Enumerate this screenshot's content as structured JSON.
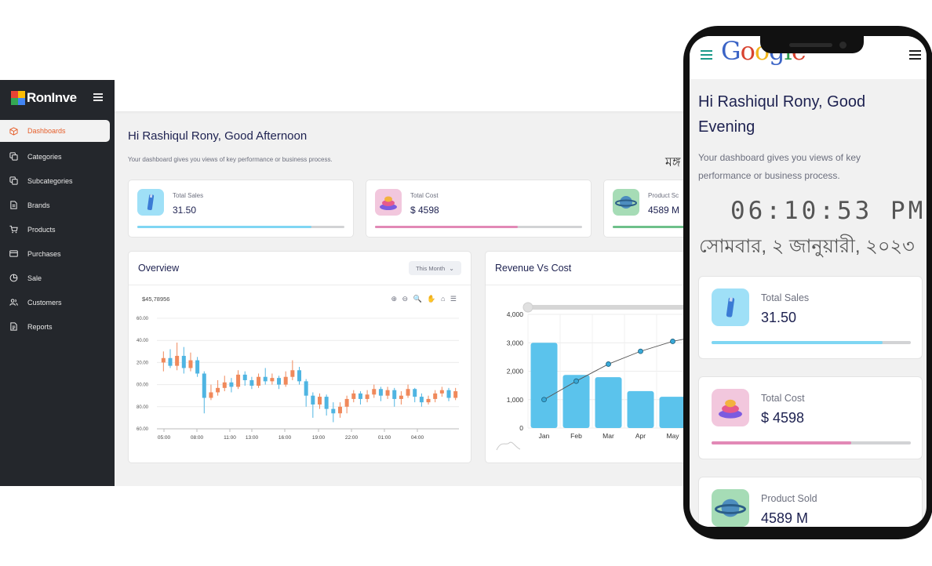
{
  "brand": {
    "name": "RonInve"
  },
  "sidebar": {
    "items": [
      {
        "label": "Dashboards",
        "icon": "cube-icon",
        "active": true
      },
      {
        "label": "Categories",
        "icon": "copy-icon"
      },
      {
        "label": "Subcategories",
        "icon": "copy-icon"
      },
      {
        "label": "Brands",
        "icon": "document-icon"
      },
      {
        "label": "Products",
        "icon": "cart-icon"
      },
      {
        "label": "Purchases",
        "icon": "card-icon"
      },
      {
        "label": "Sale",
        "icon": "pie-icon"
      },
      {
        "label": "Customers",
        "icon": "users-icon"
      },
      {
        "label": "Reports",
        "icon": "report-icon"
      }
    ]
  },
  "header": {
    "greeting": "Hi Rashiqul Rony, Good Afternoon",
    "subtitle": "Your dashboard gives you views of key performance or business process.",
    "bn_fragment": "মঙ্গ"
  },
  "stats": [
    {
      "label": "Total Sales",
      "value": "31.50",
      "progress": 0.84,
      "color": "#7fd6f3",
      "icon": "bottle-icon"
    },
    {
      "label": "Total Cost",
      "value": "$ 4598",
      "progress": 0.69,
      "color": "#e289b6",
      "icon": "stack-icon"
    },
    {
      "label": "Product Sold",
      "value": "4589 M",
      "progress": 0.5,
      "color": "#6ec08a",
      "icon": "planet-icon"
    }
  ],
  "stats_clipped": {
    "label": "Product Sc"
  },
  "overview": {
    "title": "Overview",
    "filter": "This Month",
    "price": "$45,78956",
    "toolbar": "⊕ ⊖ 🔍 ✋ ⌂ ☰"
  },
  "revenue": {
    "title": "Revenue Vs Cost"
  },
  "chart_data": [
    {
      "type": "candlestick",
      "title": "Overview",
      "x_ticks": [
        "05:00",
        "08:00",
        "11:00",
        "13:00",
        "16:00",
        "19:00",
        "22:00",
        "01:00",
        "04:00"
      ],
      "y_ticks": [
        "60.00",
        "40.00",
        "20.00",
        "00.00",
        "80.00",
        "60.00"
      ],
      "candles": [
        {
          "o": 0.6,
          "c": 0.64,
          "h": 0.7,
          "l": 0.52,
          "up": true
        },
        {
          "o": 0.64,
          "c": 0.57,
          "h": 0.72,
          "l": 0.55,
          "up": false
        },
        {
          "o": 0.57,
          "c": 0.66,
          "h": 0.78,
          "l": 0.53,
          "up": true
        },
        {
          "o": 0.66,
          "c": 0.55,
          "h": 0.74,
          "l": 0.5,
          "up": false
        },
        {
          "o": 0.55,
          "c": 0.62,
          "h": 0.69,
          "l": 0.52,
          "up": true
        },
        {
          "o": 0.62,
          "c": 0.5,
          "h": 0.65,
          "l": 0.47,
          "up": false
        },
        {
          "o": 0.5,
          "c": 0.28,
          "h": 0.52,
          "l": 0.14,
          "up": false
        },
        {
          "o": 0.28,
          "c": 0.33,
          "h": 0.4,
          "l": 0.26,
          "up": true
        },
        {
          "o": 0.33,
          "c": 0.37,
          "h": 0.44,
          "l": 0.3,
          "up": true
        },
        {
          "o": 0.37,
          "c": 0.42,
          "h": 0.48,
          "l": 0.34,
          "up": true
        },
        {
          "o": 0.42,
          "c": 0.38,
          "h": 0.46,
          "l": 0.33,
          "up": false
        },
        {
          "o": 0.38,
          "c": 0.49,
          "h": 0.53,
          "l": 0.36,
          "up": true
        },
        {
          "o": 0.49,
          "c": 0.44,
          "h": 0.52,
          "l": 0.39,
          "up": false
        },
        {
          "o": 0.44,
          "c": 0.39,
          "h": 0.47,
          "l": 0.36,
          "up": false
        },
        {
          "o": 0.39,
          "c": 0.47,
          "h": 0.5,
          "l": 0.37,
          "up": true
        },
        {
          "o": 0.47,
          "c": 0.43,
          "h": 0.55,
          "l": 0.4,
          "up": false
        },
        {
          "o": 0.43,
          "c": 0.46,
          "h": 0.5,
          "l": 0.4,
          "up": true
        },
        {
          "o": 0.46,
          "c": 0.4,
          "h": 0.48,
          "l": 0.36,
          "up": false
        },
        {
          "o": 0.4,
          "c": 0.47,
          "h": 0.52,
          "l": 0.38,
          "up": true
        },
        {
          "o": 0.47,
          "c": 0.53,
          "h": 0.62,
          "l": 0.44,
          "up": true
        },
        {
          "o": 0.53,
          "c": 0.43,
          "h": 0.56,
          "l": 0.4,
          "up": false
        },
        {
          "o": 0.43,
          "c": 0.3,
          "h": 0.45,
          "l": 0.2,
          "up": false
        },
        {
          "o": 0.3,
          "c": 0.22,
          "h": 0.33,
          "l": 0.1,
          "up": false
        },
        {
          "o": 0.22,
          "c": 0.29,
          "h": 0.32,
          "l": 0.18,
          "up": true
        },
        {
          "o": 0.29,
          "c": 0.18,
          "h": 0.31,
          "l": 0.12,
          "up": false
        },
        {
          "o": 0.18,
          "c": 0.14,
          "h": 0.24,
          "l": 0.06,
          "up": false
        },
        {
          "o": 0.14,
          "c": 0.2,
          "h": 0.24,
          "l": 0.1,
          "up": true
        },
        {
          "o": 0.2,
          "c": 0.27,
          "h": 0.3,
          "l": 0.14,
          "up": true
        },
        {
          "o": 0.27,
          "c": 0.32,
          "h": 0.35,
          "l": 0.24,
          "up": true
        },
        {
          "o": 0.32,
          "c": 0.27,
          "h": 0.34,
          "l": 0.22,
          "up": false
        },
        {
          "o": 0.27,
          "c": 0.31,
          "h": 0.35,
          "l": 0.24,
          "up": true
        },
        {
          "o": 0.31,
          "c": 0.36,
          "h": 0.4,
          "l": 0.28,
          "up": true
        },
        {
          "o": 0.36,
          "c": 0.3,
          "h": 0.38,
          "l": 0.25,
          "up": false
        },
        {
          "o": 0.3,
          "c": 0.35,
          "h": 0.38,
          "l": 0.27,
          "up": true
        },
        {
          "o": 0.35,
          "c": 0.27,
          "h": 0.37,
          "l": 0.2,
          "up": false
        },
        {
          "o": 0.27,
          "c": 0.3,
          "h": 0.34,
          "l": 0.22,
          "up": true
        },
        {
          "o": 0.3,
          "c": 0.36,
          "h": 0.4,
          "l": 0.28,
          "up": true
        },
        {
          "o": 0.36,
          "c": 0.29,
          "h": 0.37,
          "l": 0.24,
          "up": false
        },
        {
          "o": 0.29,
          "c": 0.24,
          "h": 0.32,
          "l": 0.2,
          "up": false
        },
        {
          "o": 0.24,
          "c": 0.27,
          "h": 0.3,
          "l": 0.22,
          "up": true
        },
        {
          "o": 0.27,
          "c": 0.32,
          "h": 0.35,
          "l": 0.24,
          "up": true
        },
        {
          "o": 0.32,
          "c": 0.35,
          "h": 0.38,
          "l": 0.29,
          "up": true
        },
        {
          "o": 0.35,
          "c": 0.28,
          "h": 0.37,
          "l": 0.25,
          "up": false
        },
        {
          "o": 0.28,
          "c": 0.34,
          "h": 0.37,
          "l": 0.26,
          "up": true
        }
      ]
    },
    {
      "type": "bar+line",
      "title": "Revenue Vs Cost",
      "categories": [
        "Jan",
        "Feb",
        "Mar",
        "Apr",
        "May"
      ],
      "ylim": [
        0,
        4000
      ],
      "y_ticks": [
        "4,000",
        "3,000",
        "2,000",
        "1,000",
        "0"
      ],
      "series": [
        {
          "type": "bar",
          "values": [
            3000,
            1870,
            1790,
            1300,
            1100
          ]
        },
        {
          "type": "line",
          "values": [
            1000,
            1650,
            2250,
            2700,
            3050
          ]
        }
      ]
    }
  ],
  "phone": {
    "greeting": "Hi Rashiqul Rony, Good Evening",
    "subtitle": "Your dashboard gives you views of key performance or business process.",
    "clock": "06:10:53 PM",
    "date": "সোমবার, ২ জানুয়ারী, ২০২৩",
    "google": [
      "G",
      "o",
      "o",
      "g",
      "l",
      "e"
    ],
    "google_colors": [
      "#3b64c6",
      "#d8432f",
      "#f2b51c",
      "#3b64c6",
      "#2f9b50",
      "#d8432f"
    ],
    "cards": [
      {
        "label": "Total Sales",
        "value": "31.50",
        "progress": 0.86,
        "color": "#7fd6f3",
        "icon": "bottle-icon"
      },
      {
        "label": "Total Cost",
        "value": "$ 4598",
        "progress": 0.7,
        "color": "#e289b6",
        "icon": "stack-icon"
      },
      {
        "label": "Product Sold",
        "value": "4589 M",
        "progress": 0.5,
        "color": "#6ec08a",
        "icon": "planet-icon"
      }
    ]
  }
}
